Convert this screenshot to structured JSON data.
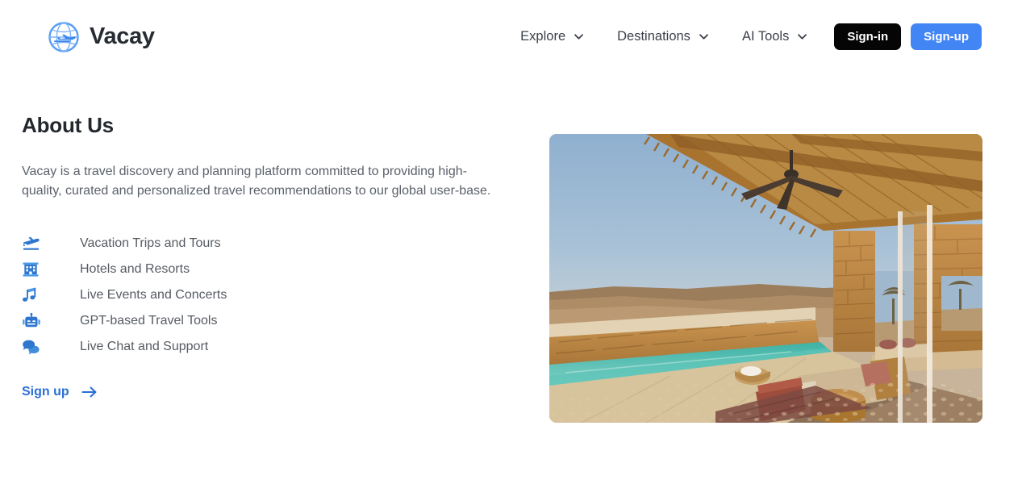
{
  "header": {
    "brand": {
      "name": "Vacay",
      "logo_icon": "globe-plane-icon",
      "logo_color": "#4a8cf7"
    },
    "nav": [
      {
        "label": "Explore",
        "icon": "chevron-down-icon"
      },
      {
        "label": "Destinations",
        "icon": "chevron-down-icon"
      },
      {
        "label": "AI Tools",
        "icon": "chevron-down-icon"
      }
    ],
    "auth": {
      "signin_label": "Sign-in",
      "signin_bg": "#050505",
      "signup_label": "Sign-up",
      "signup_bg": "#4285f4"
    }
  },
  "main": {
    "title": "About Us",
    "intro": "Vacay is a travel discovery and planning platform committed to providing high-quality, curated and personalized travel recommendations to our global user-base.",
    "features": [
      {
        "label": "Vacation Trips and Tours",
        "icon": "plane-departure-icon"
      },
      {
        "label": "Hotels and Resorts",
        "icon": "hotel-building-icon"
      },
      {
        "label": "Live Events and Concerts",
        "icon": "music-note-icon"
      },
      {
        "label": "GPT-based Travel Tools",
        "icon": "robot-icon"
      },
      {
        "label": "Live Chat and Support",
        "icon": "chat-bubbles-icon"
      }
    ],
    "cta": {
      "label": "Sign up",
      "icon": "arrow-right-icon",
      "color": "#2b6fd4"
    },
    "hero": {
      "alt": "Desert resort terrace with infinity pool, stone walls, thatched wooden roof and lounge seating",
      "sky_color": "#9fb9d2",
      "pool_color": "#4fbdb0",
      "stone_color": "#b98a50",
      "sand_color": "#d9c6a6"
    }
  },
  "icon_colors": {
    "feature_icon": "#2e76ce",
    "feature_icon_light": "#4a9ae8"
  }
}
